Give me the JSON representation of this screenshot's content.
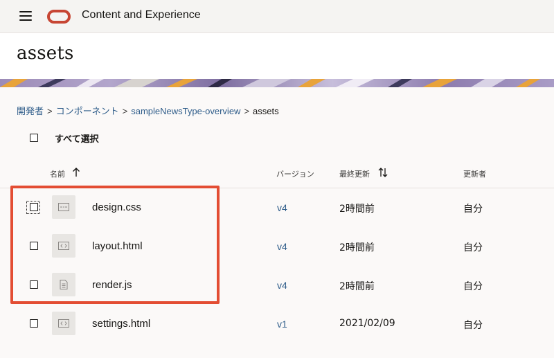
{
  "topbar": {
    "menu_icon": "hamburger-menu-icon",
    "logo_icon": "oracle-logo-icon",
    "brand_color": "#c74634",
    "app_title": "Content and Experience"
  },
  "page": {
    "title": "assets"
  },
  "breadcrumb": {
    "items": [
      "開発者",
      "コンポーネント",
      "sampleNewsType-overview"
    ],
    "separator": ">",
    "current": "assets",
    "link_color": "#2f5d8a"
  },
  "select_all": {
    "label": "すべて選択"
  },
  "table": {
    "columns": {
      "name": "名前",
      "version": "バージョン",
      "modified": "最終更新",
      "modified_by": "更新者"
    },
    "rows": [
      {
        "name": "design.css",
        "icon": "css-file-icon",
        "version": "v4",
        "modified": "2時間前",
        "modified_by": "自分"
      },
      {
        "name": "layout.html",
        "icon": "html-file-icon",
        "version": "v4",
        "modified": "2時間前",
        "modified_by": "自分"
      },
      {
        "name": "render.js",
        "icon": "js-file-icon",
        "version": "v4",
        "modified": "2時間前",
        "modified_by": "自分"
      },
      {
        "name": "settings.html",
        "icon": "html-file-icon",
        "version": "v1",
        "modified": "2021/02/09",
        "modified_by": "自分"
      }
    ]
  },
  "highlight_color": "#e34d33"
}
